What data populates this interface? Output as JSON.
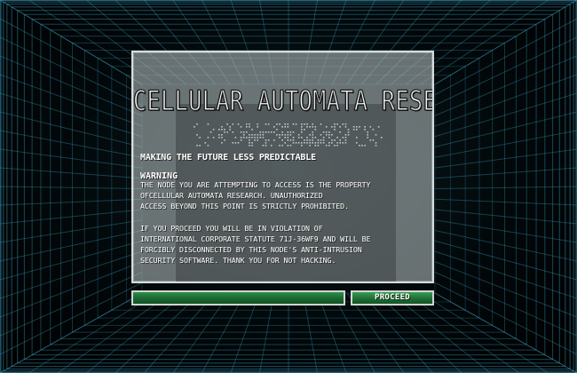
{
  "panel": {
    "title": "CELLULAR AUTOMATA RESEARCH",
    "tagline": "MAKING THE FUTURE LESS PREDICTABLE",
    "warning_heading": "WARNING",
    "body_lines": [
      "THE NODE YOU ARE ATTEMPTING TO ACCESS IS THE PROPERTY",
      "OFCELLULAR AUTOMATA RESEARCH. UNAUTHORIZED",
      "ACCESS BEYOND THIS POINT IS STRICTLY PROHIBITED.",
      "IF YOU PROCEED YOU WILL BE IN VIOLATION OF",
      "INTERNATIONAL CORPORATE STATUTE 71J-36WF9 AND WILL BE",
      "FORCIBLY DISCONNECTED BY THIS NODE'S ANTI-INTRUSION",
      "SECURITY SOFTWARE. THANK YOU FOR NOT HACKING."
    ]
  },
  "progress": {
    "value": 1.0
  },
  "actions": {
    "proceed_label": "PROCEED"
  },
  "colors": {
    "grid": "#3fa3c4",
    "accent_green": "#1f6e35",
    "panel_border": "#d7dcdc"
  },
  "icons": {
    "automata_pattern": "dot-matrix-pattern-icon"
  }
}
